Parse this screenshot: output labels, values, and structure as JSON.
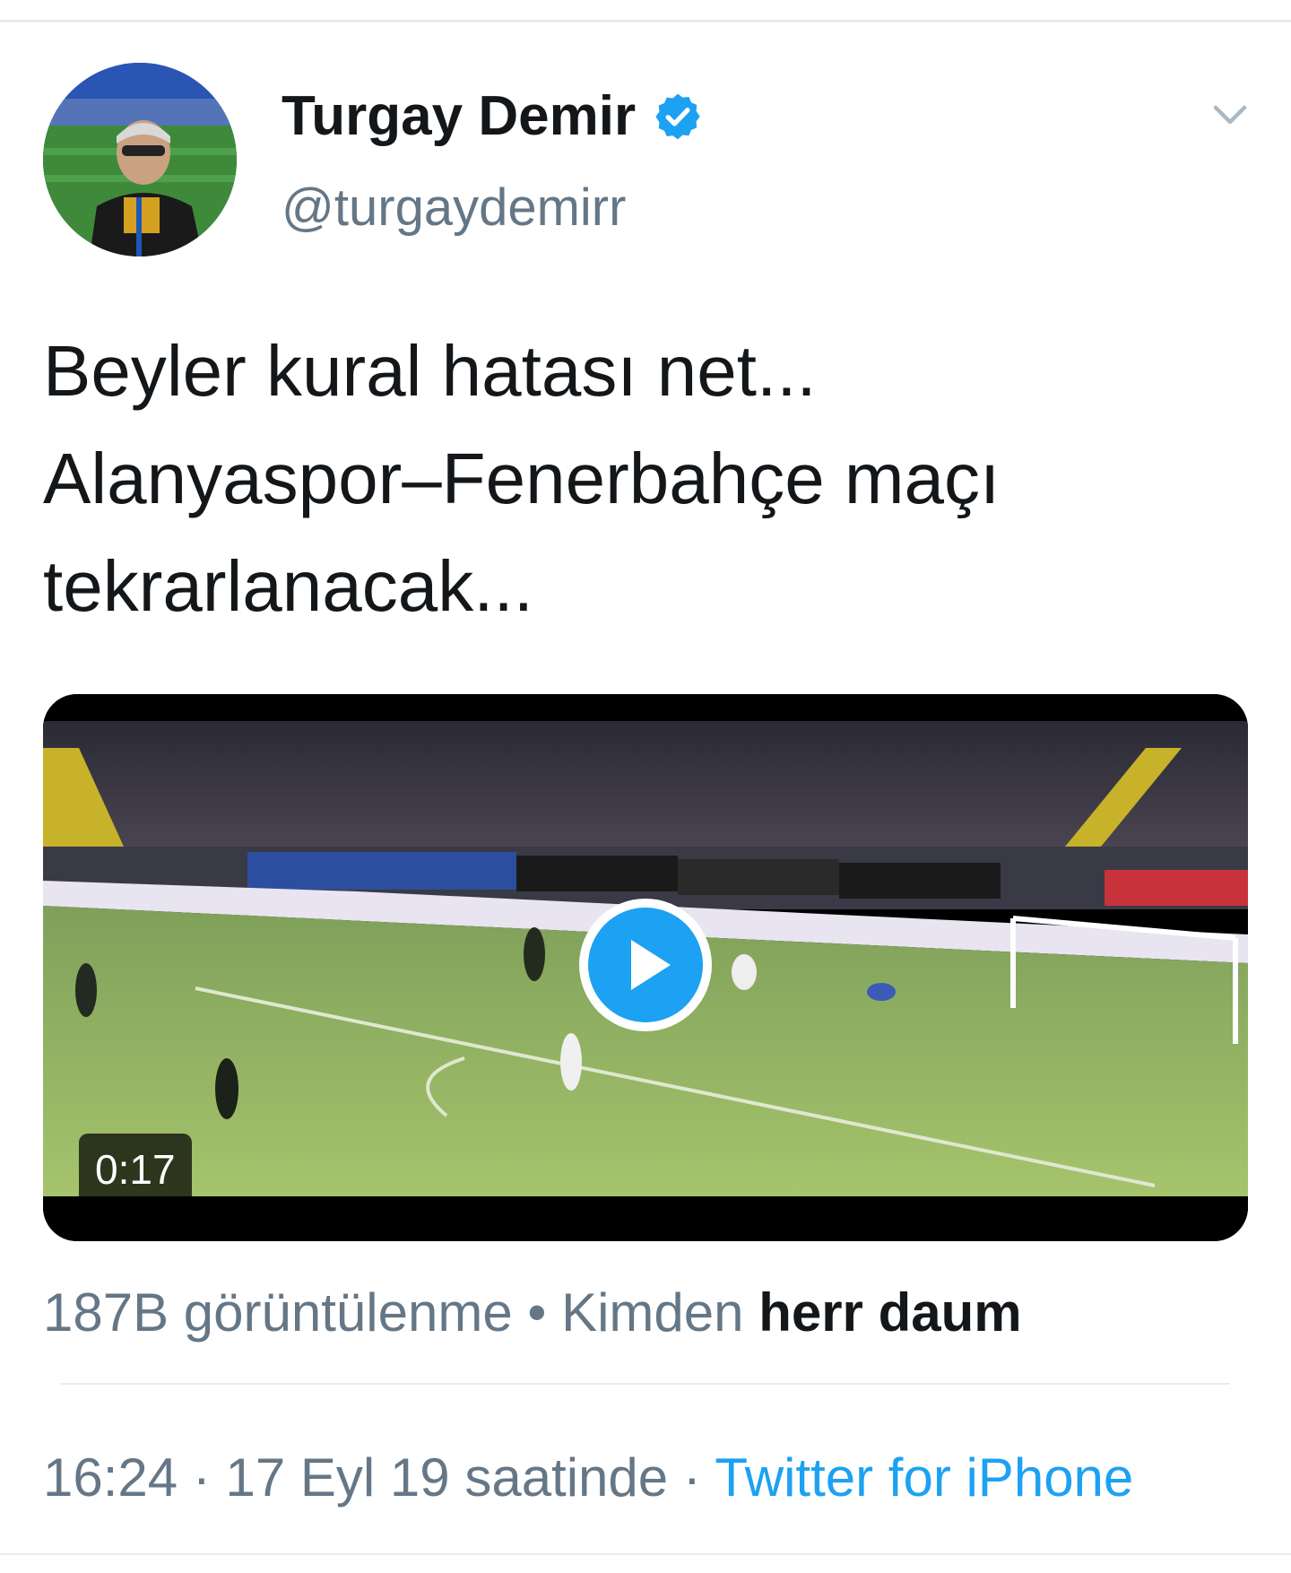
{
  "author": {
    "display_name": "Turgay Demir",
    "handle": "@turgaydemirr",
    "verified_icon": "verified-badge-icon",
    "avatar_icon": "profile-photo"
  },
  "menu_icon": "chevron-down-icon",
  "tweet": {
    "lines": [
      "Beyler kural hatası net...",
      "Alanyaspor–Fenerbahçe maçı",
      "tekrarlanacak..."
    ]
  },
  "media": {
    "type": "video",
    "duration": "0:17",
    "play_icon": "play-icon"
  },
  "stats": {
    "views": "187B görüntülenme",
    "separator": "•",
    "from_label": "Kimden",
    "source_account": "herr daum"
  },
  "meta": {
    "time": "16:24",
    "separator": "·",
    "date": "17 Eyl 19 saatinde",
    "client": "Twitter for iPhone"
  },
  "colors": {
    "link_blue": "#1da1f2",
    "secondary_text": "#657786",
    "primary_text": "#14171a",
    "divider": "#e6ecf0"
  }
}
